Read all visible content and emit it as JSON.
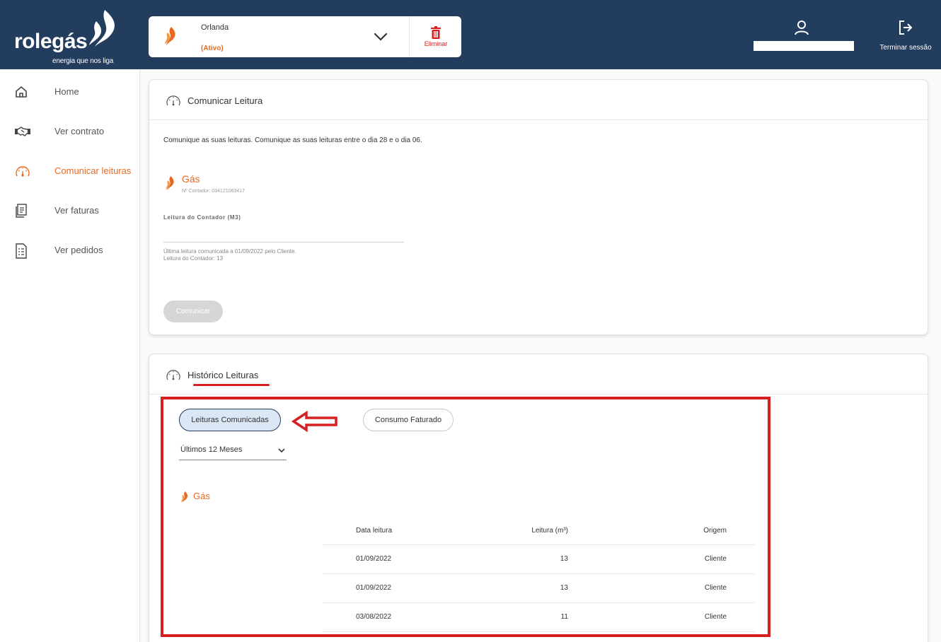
{
  "brand": {
    "name": "rolegás",
    "tagline": "energia que nos liga"
  },
  "contract": {
    "name": "Orlanda",
    "status": "(Ativo)",
    "delete_label": "Eliminar"
  },
  "user": {
    "name": "",
    "logout_label": "Terminar sessão"
  },
  "sidebar": {
    "items": [
      {
        "label": "Home",
        "icon": "home-icon",
        "active": false
      },
      {
        "label": "Ver contrato",
        "icon": "handshake-icon",
        "active": false
      },
      {
        "label": "Comunicar leituras",
        "icon": "gauge-icon",
        "active": true
      },
      {
        "label": "Ver faturas",
        "icon": "invoice-icon",
        "active": false
      },
      {
        "label": "Ver pedidos",
        "icon": "list-document-icon",
        "active": false
      }
    ]
  },
  "reading_card": {
    "title": "Comunicar Leitura",
    "intro": "Comunique as suas leituras. Comunique as suas leituras entre o dia 28 e o dia 06.",
    "gas_title": "Gás",
    "meter_number": "Nº Contador: 034121063417",
    "meter_field_label": "Leitura do Contador (M3)",
    "meter_value": "",
    "last_reading_line1": "Última leitura comunicada a 01/09/2022 pelo Cliente.",
    "last_reading_line2": "Leitura do Contador: 13",
    "submit_label": "Comunicar"
  },
  "history_card": {
    "title": "Histórico Leituras",
    "tabs": {
      "communicated": "Leituras Comunicadas",
      "billed": "Consumo Faturado"
    },
    "period": "Últimos 12 Meses",
    "gas_title": "Gás",
    "table": {
      "headers": {
        "date": "Data leitura",
        "reading": "Leitura (m³)",
        "origin": "Origem"
      },
      "rows": [
        {
          "date": "01/09/2022",
          "reading": "13",
          "origin": "Cliente"
        },
        {
          "date": "01/09/2022",
          "reading": "13",
          "origin": "Cliente"
        },
        {
          "date": "03/08/2022",
          "reading": "11",
          "origin": "Cliente"
        }
      ]
    }
  },
  "colors": {
    "header_bg": "#233d5e",
    "accent": "#e8691f",
    "annotation": "#d6201f"
  }
}
